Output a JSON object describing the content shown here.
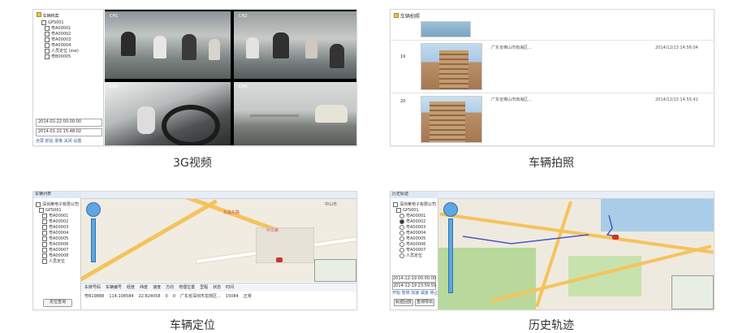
{
  "captions": {
    "video": "3G视频",
    "photo": "车辆拍照",
    "location": "车辆定位",
    "track": "历史轨迹"
  },
  "video_panel": {
    "tree_root": "车辆档案",
    "tree_items": [
      "GPS001",
      "粤A00001",
      "粤A00002",
      "粤A00003",
      "粤A00004",
      "人员定位 (zse)",
      "粤B00005"
    ],
    "date_start": "2014-01-22 00:00:00",
    "date_end": "2014-01-22 15:48:02",
    "bottom_actions": "全屏 抓拍 录像 关闭 设置"
  },
  "photo_panel": {
    "title": "车辆拍照",
    "rows": [
      {
        "index": "19",
        "address": "广东省佛山市南海区...",
        "time": "2014/12/13 14:56:04"
      },
      {
        "index": "20",
        "address": "广东省佛山市南海区...",
        "time": "2014/12/13 14:55:41"
      }
    ]
  },
  "location_panel": {
    "tab": "车辆列表",
    "tree_items": [
      "深圳某电子有限公司",
      "GPS001",
      "粤A00001",
      "粤A00002",
      "粤A00003",
      "粤A00004",
      "粤A00005",
      "粤A00006",
      "粤A00007",
      "粤A00008",
      "人员定位"
    ],
    "map_labels": [
      "东昌东路",
      "中华路"
    ],
    "map_label_right": "中山市",
    "table_headers": [
      "车牌号码",
      "车辆编号",
      "经度",
      "纬度",
      "速度",
      "方向",
      "地理位置",
      "里程",
      "状态",
      "时间"
    ],
    "table_row": [
      "粤B19888",
      "114.108584",
      "22.824058",
      "22.824058",
      "0",
      "0",
      "广东省深圳市龙岗区...",
      "15084",
      "正常",
      "2014/12/22 15:33:02"
    ],
    "bottom_button": "定位查询"
  },
  "track_panel": {
    "tab": "历史轨迹",
    "tree_items": [
      "深圳某电子有限公司",
      "GPS001",
      "粤A00001",
      "粤A00002",
      "粤A00003",
      "粤A00004",
      "粤A00005",
      "粤A00006",
      "粤A00007",
      "人员定位"
    ],
    "date_start": "2014-12-19 00:00:00",
    "date_end": "2014-12-19 23:59:59",
    "controls": "开始 暂停 加速 减速 停止",
    "buttons": [
      "轨迹回放",
      "查询导出"
    ]
  },
  "colors": {
    "map_bg": "#f1ece1",
    "map_road": "#f4c35b",
    "map_green": "#b8d99b",
    "map_water": "#a9cde8",
    "track_line": "#4a55c4"
  }
}
